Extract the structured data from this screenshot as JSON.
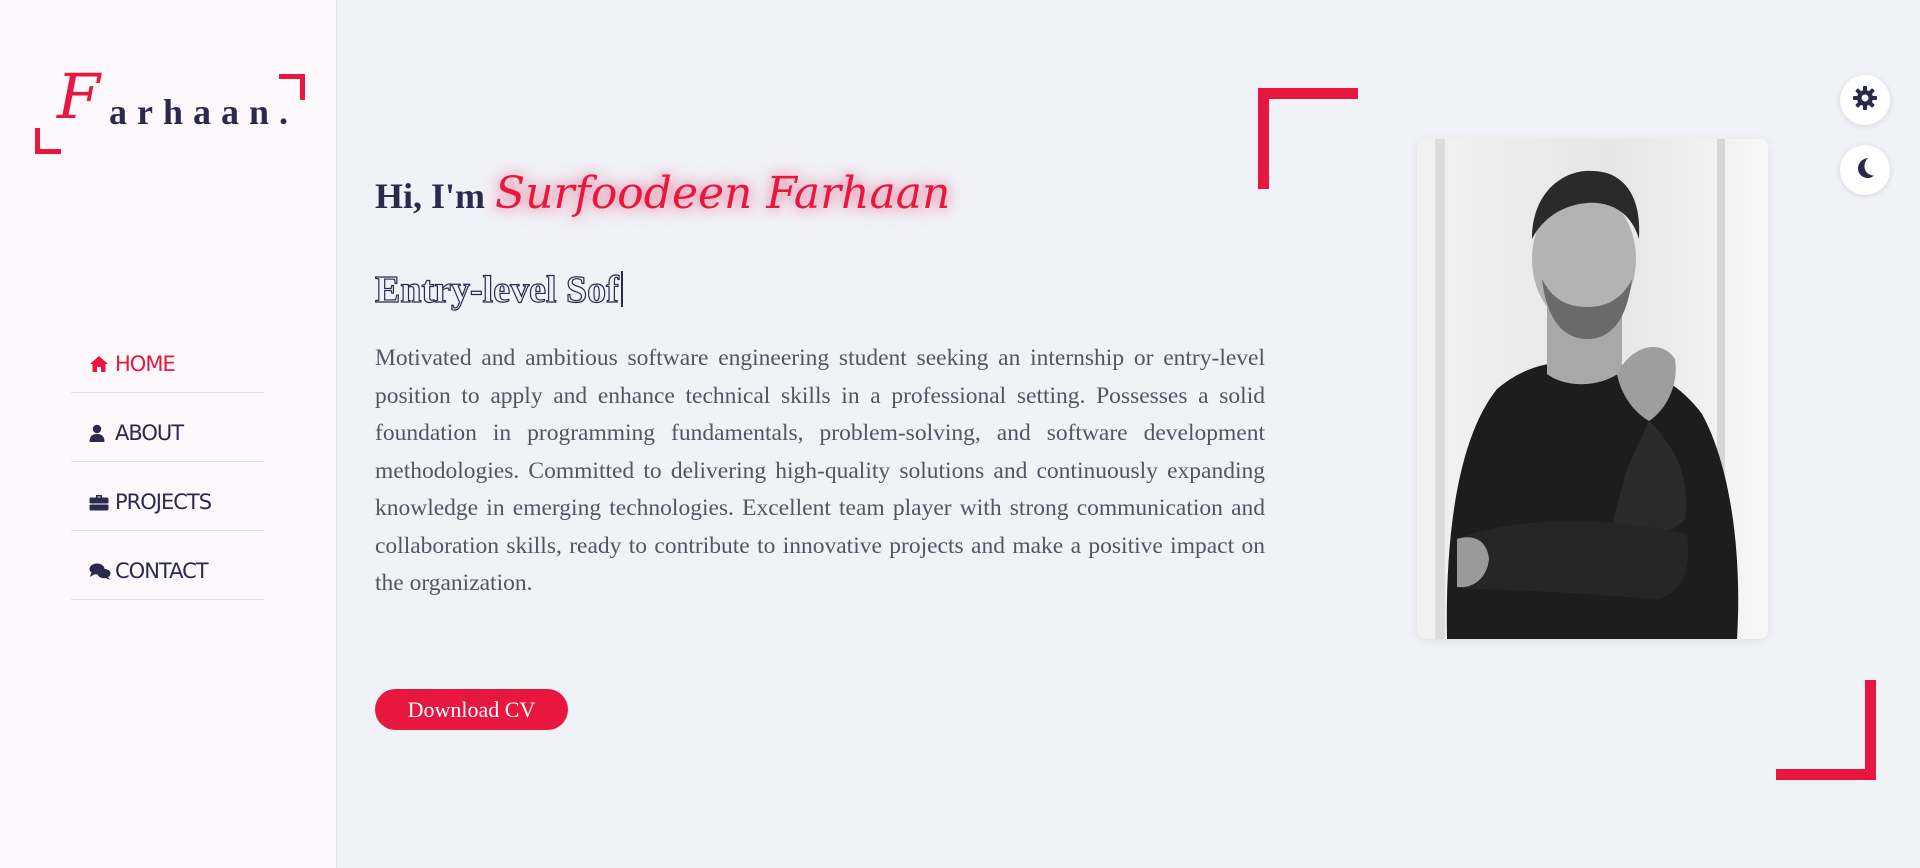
{
  "logo": {
    "initial": "F",
    "rest": "arhaan."
  },
  "nav": [
    {
      "label": "HOME",
      "icon": "home-icon",
      "active": true
    },
    {
      "label": "ABOUT",
      "icon": "user-icon",
      "active": false
    },
    {
      "label": "PROJECTS",
      "icon": "briefcase-icon",
      "active": false
    },
    {
      "label": "CONTACT",
      "icon": "comments-icon",
      "active": false
    }
  ],
  "hero": {
    "greeting": "Hi, I'm",
    "name": "Surfoodeen Farhaan",
    "typed_role": "Entry-level Sof",
    "bio": "Motivated and ambitious software engineering student seeking an internship or entry-level position to apply and enhance technical skills in a professional setting. Possesses a solid foundation in programming fundamentals, problem-solving, and software development methodologies. Committed to delivering high-quality solutions and continuously expanding knowledge in emerging technologies. Excellent team player with strong communication and collaboration skills, ready to contribute to innovative projects and make a positive impact on the organization.",
    "cv_button": "Download CV"
  },
  "controls": {
    "settings_icon": "gear-icon",
    "theme_icon": "moon-icon"
  },
  "colors": {
    "accent": "#e8173f",
    "text": "#2b2a4c",
    "background": "#f1f1f8",
    "sidebar": "#fcf8fc"
  }
}
